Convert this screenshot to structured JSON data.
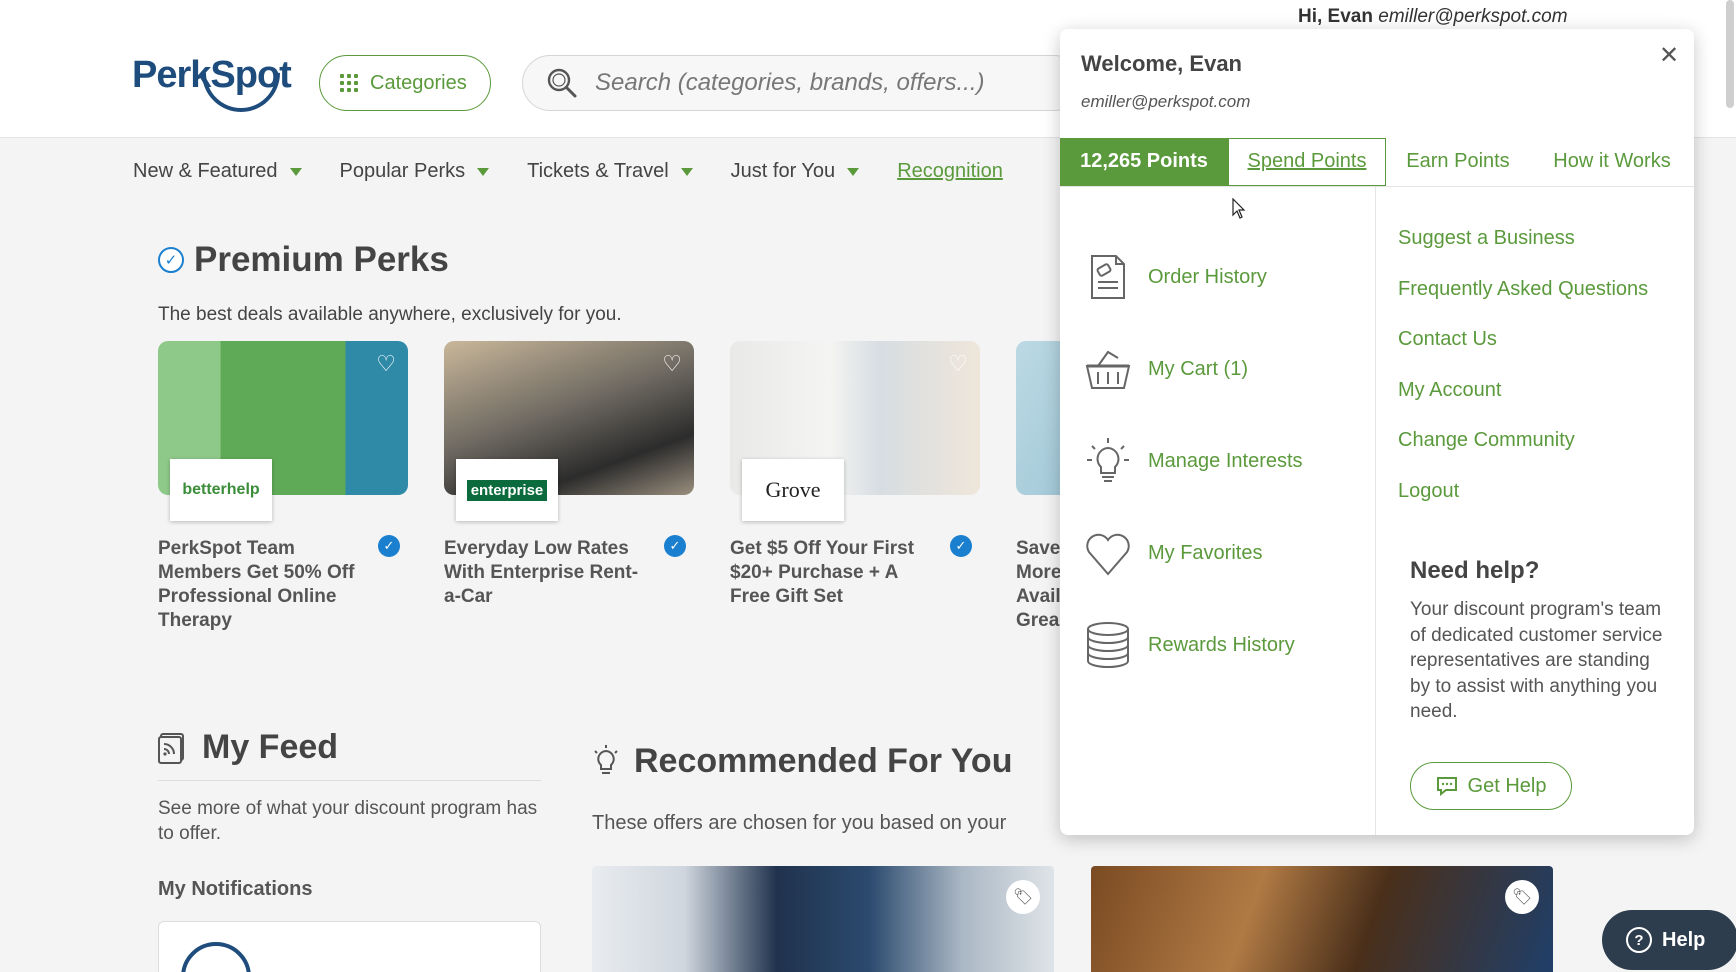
{
  "header": {
    "greeting_name": "Hi, Evan",
    "greeting_email": "emiller@perkspot.com",
    "logo_text": "PerkSpot",
    "categories_label": "Categories",
    "search_placeholder": "Search (categories, brands, offers...)"
  },
  "nav": {
    "items": [
      {
        "label": "New & Featured"
      },
      {
        "label": "Popular Perks"
      },
      {
        "label": "Tickets & Travel"
      },
      {
        "label": "Just for You"
      }
    ],
    "link": "Recognition"
  },
  "premium": {
    "title": "Premium Perks",
    "subtitle": "The best deals available anywhere, exclusively for you.",
    "cards": [
      {
        "brand": "betterhelp",
        "title": "PerkSpot Team Members Get 50% Off Professional Online Therapy"
      },
      {
        "brand": "enterprise",
        "title": "Everyday Low Rates With Enterprise Rent-a-Car"
      },
      {
        "brand": "Grove",
        "title": "Get $5 Off Your First $20+ Purchase + A Free Gift Set"
      },
      {
        "brand": "",
        "title": "Save More Avail Grea"
      }
    ]
  },
  "feed": {
    "title": "My Feed",
    "subtitle": "See more of what your discount program has to offer.",
    "notifications_title": "My Notifications"
  },
  "recommended": {
    "title": "Recommended For You",
    "subtitle": "These offers are chosen for you based on your"
  },
  "help_button": "Help",
  "dropdown": {
    "welcome": "Welcome, Evan",
    "email": "emiller@perkspot.com",
    "tabs": {
      "points": "12,265 Points",
      "spend": "Spend Points",
      "earn": "Earn Points",
      "how": "How it Works"
    },
    "left_items": [
      {
        "label": "Order History",
        "icon": "receipt-icon"
      },
      {
        "label": "My Cart (1)",
        "icon": "basket-icon"
      },
      {
        "label": "Manage Interests",
        "icon": "lightbulb-icon"
      },
      {
        "label": "My Favorites",
        "icon": "heart-icon"
      },
      {
        "label": "Rewards History",
        "icon": "coins-stack-icon"
      }
    ],
    "right_links": [
      {
        "label": "Suggest a Business"
      },
      {
        "label": "Frequently Asked Questions"
      },
      {
        "label": "Contact Us"
      },
      {
        "label": "My Account"
      },
      {
        "label": "Change Community"
      },
      {
        "label": "Logout"
      }
    ],
    "need_help": {
      "title": "Need help?",
      "body": "Your discount program's team of dedicated customer service representatives are standing by to assist with anything you need.",
      "button": "Get Help"
    }
  },
  "colors": {
    "brand_green": "#5b9a3c",
    "brand_navy": "#1e4c7c",
    "check_blue": "#1a7fcf"
  }
}
